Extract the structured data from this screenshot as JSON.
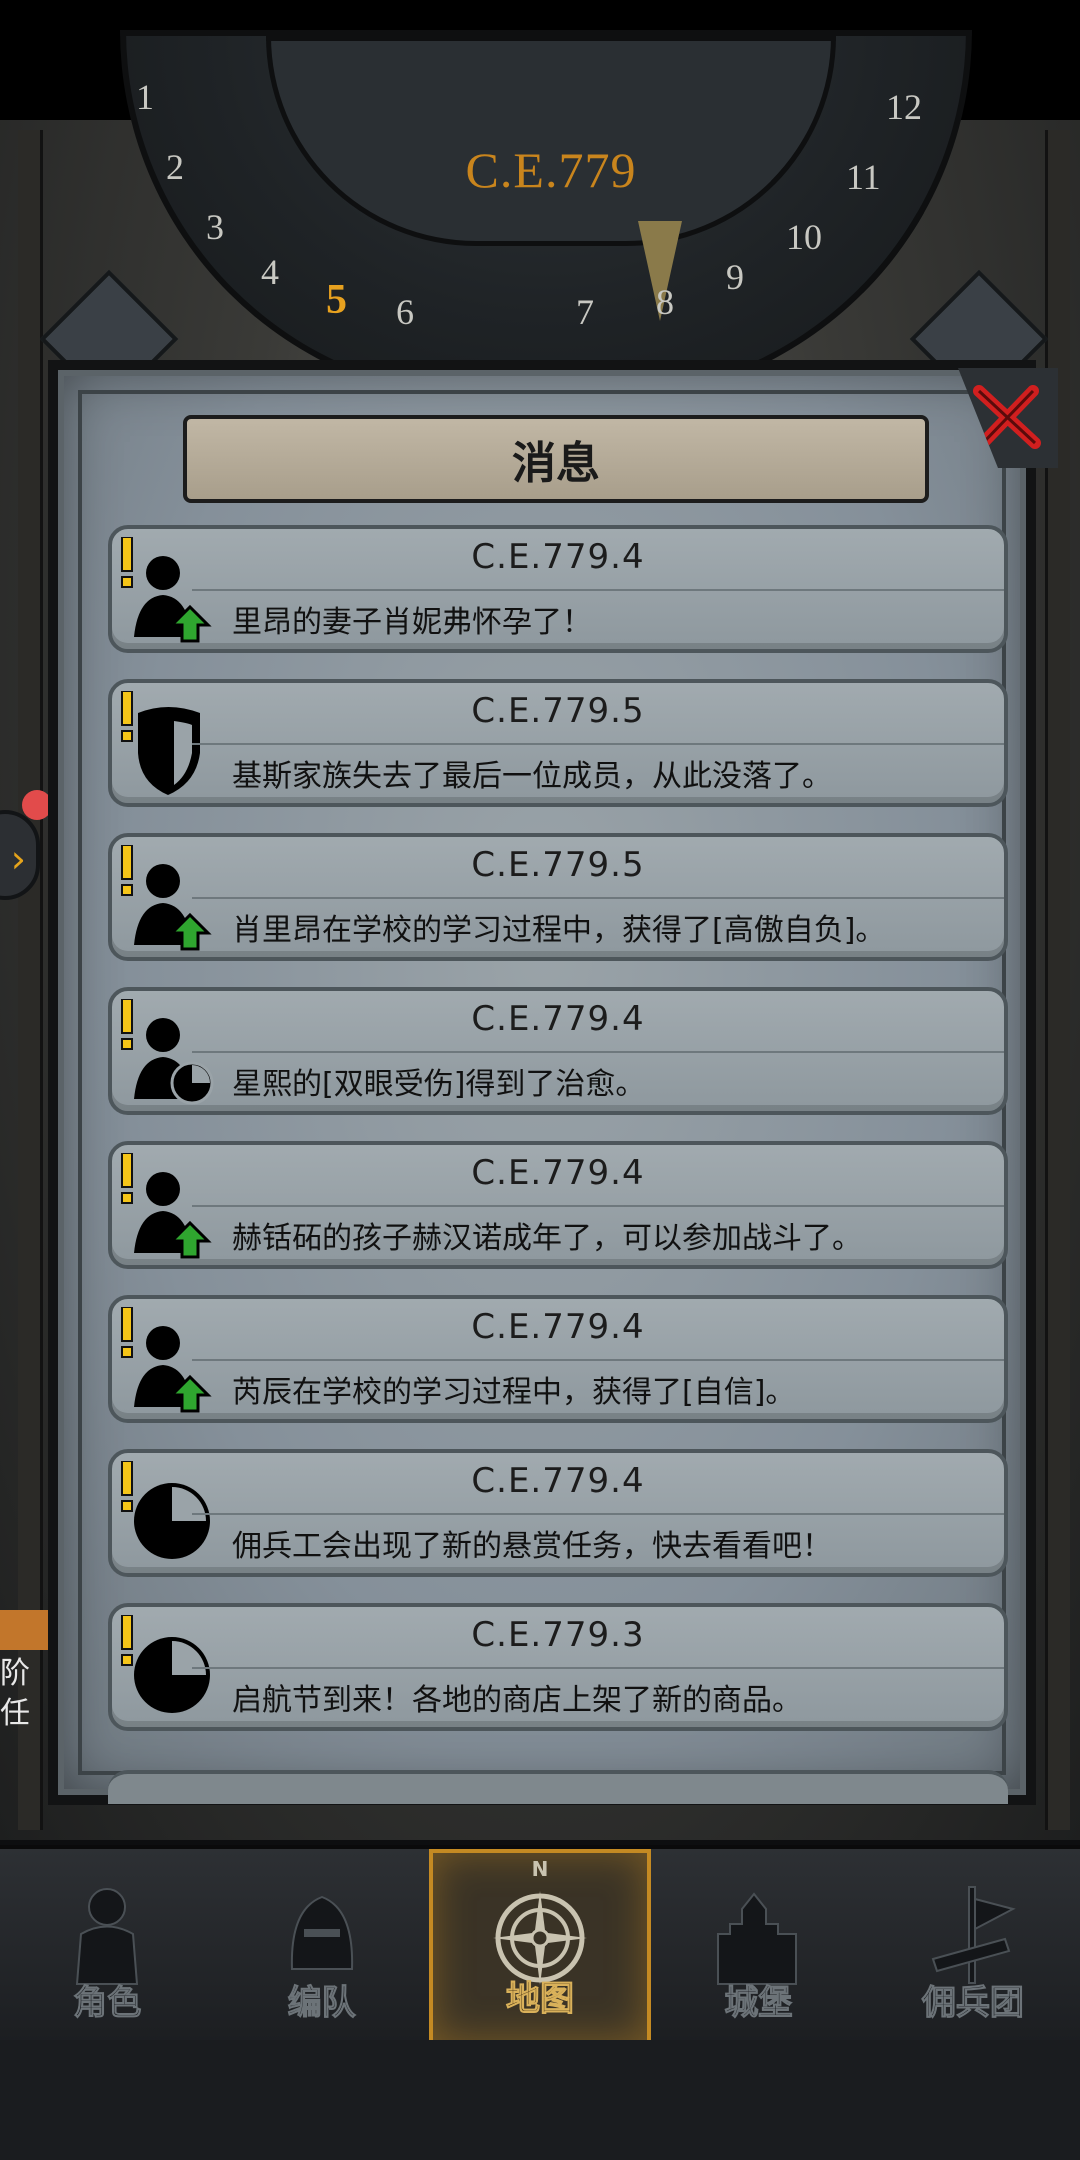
{
  "calendar": {
    "year": "C.E.779",
    "months": [
      "1",
      "2",
      "3",
      "4",
      "5",
      "6",
      "7",
      "8",
      "9",
      "10",
      "11",
      "12"
    ],
    "current_month": "5"
  },
  "panel": {
    "title": "消息",
    "messages": [
      {
        "date": "C.E.779.4",
        "text": "里昂的妻子肖妮弗怀孕了！",
        "icon": "person-up-icon"
      },
      {
        "date": "C.E.779.5",
        "text": "基斯家族失去了最后一位成员，从此没落了。",
        "icon": "shield-icon"
      },
      {
        "date": "C.E.779.5",
        "text": "肖里昂在学校的学习过程中，获得了[高傲自负]。",
        "icon": "person-up-icon"
      },
      {
        "date": "C.E.779.4",
        "text": "星熙的[双眼受伤]得到了治愈。",
        "icon": "person-clock-icon"
      },
      {
        "date": "C.E.779.4",
        "text": "赫铦砳的孩子赫汉诺成年了，可以参加战斗了。",
        "icon": "person-up-icon"
      },
      {
        "date": "C.E.779.4",
        "text": "芮辰在学校的学习过程中，获得了[自信]。",
        "icon": "person-up-icon"
      },
      {
        "date": "C.E.779.4",
        "text": "佣兵工会出现了新的悬赏任务，快去看看吧！",
        "icon": "clock-icon"
      },
      {
        "date": "C.E.779.3",
        "text": "启航节到来！各地的商店上架了新的商品。",
        "icon": "clock-icon"
      }
    ]
  },
  "side_quest": {
    "line1": "阶",
    "line2": "任"
  },
  "nav": {
    "items": [
      {
        "label": "角色",
        "icon": "knight-icon",
        "active": false
      },
      {
        "label": "编队",
        "icon": "helmet-icon",
        "active": false
      },
      {
        "label": "地图",
        "icon": "compass-icon",
        "active": true
      },
      {
        "label": "城堡",
        "icon": "castle-icon",
        "active": false
      },
      {
        "label": "佣兵团",
        "icon": "banner-icon",
        "active": false
      }
    ],
    "compass_letter": "N"
  },
  "colors": {
    "accent": "#c48a23",
    "year": "#c9851d",
    "alert": "#f5c518",
    "arrow_up": "#2fa52f",
    "close": "#d11f1f"
  }
}
